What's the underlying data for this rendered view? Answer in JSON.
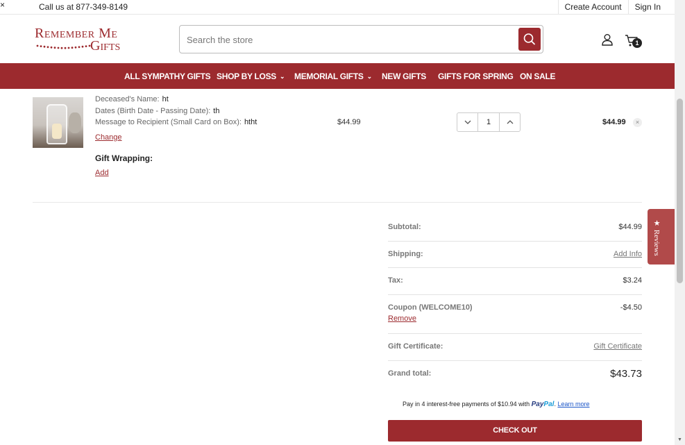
{
  "topbar": {
    "phone": "Call us at 877-349-8149",
    "create_account": "Create Account",
    "sign_in": "Sign In",
    "close": "×"
  },
  "header": {
    "logo_line1": "Remember Me",
    "logo_line2": "Gifts",
    "search_placeholder": "Search the store",
    "cart_count": "1"
  },
  "nav": {
    "items": [
      {
        "label": "ALL SYMPATHY GIFTS",
        "dropdown": false
      },
      {
        "label": "SHOP BY LOSS",
        "dropdown": true
      },
      {
        "label": "MEMORIAL GIFTS",
        "dropdown": true
      },
      {
        "label": "NEW GIFTS",
        "dropdown": false
      },
      {
        "label": "GIFTS FOR SPRING",
        "dropdown": false
      },
      {
        "label": "ON SALE",
        "dropdown": false
      }
    ]
  },
  "cart_item": {
    "options": [
      {
        "label": "Deceased's Name:",
        "value": "ht"
      },
      {
        "label": "Dates (Birth Date - Passing Date):",
        "value": "th"
      },
      {
        "label": "Message to Recipient (Small Card on Box):",
        "value": "htht"
      }
    ],
    "change_label": "Change",
    "gift_wrapping_label": "Gift Wrapping:",
    "gift_wrapping_add": "Add",
    "unit_price": "$44.99",
    "quantity": "1",
    "line_total": "$44.99"
  },
  "totals": {
    "subtotal_label": "Subtotal:",
    "subtotal_value": "$44.99",
    "shipping_label": "Shipping:",
    "shipping_value": "Add Info",
    "tax_label": "Tax:",
    "tax_value": "$3.24",
    "coupon_label": "Coupon (WELCOME10)",
    "coupon_value": "-$4.50",
    "coupon_remove": "Remove",
    "gift_cert_label": "Gift Certificate:",
    "gift_cert_value": "Gift Certificate",
    "grand_total_label": "Grand total:",
    "grand_total_value": "$43.73"
  },
  "paypal": {
    "text": "Pay in 4 interest-free payments of $10.94 with",
    "brand_pay": "Pay",
    "brand_pal": "Pal",
    "learn_more": "Learn more"
  },
  "checkout_label": "CHECK OUT",
  "reviews_tab": "Reviews",
  "colors": {
    "brand": "#9c2a2e",
    "reviews_tab": "#b14a4a"
  }
}
